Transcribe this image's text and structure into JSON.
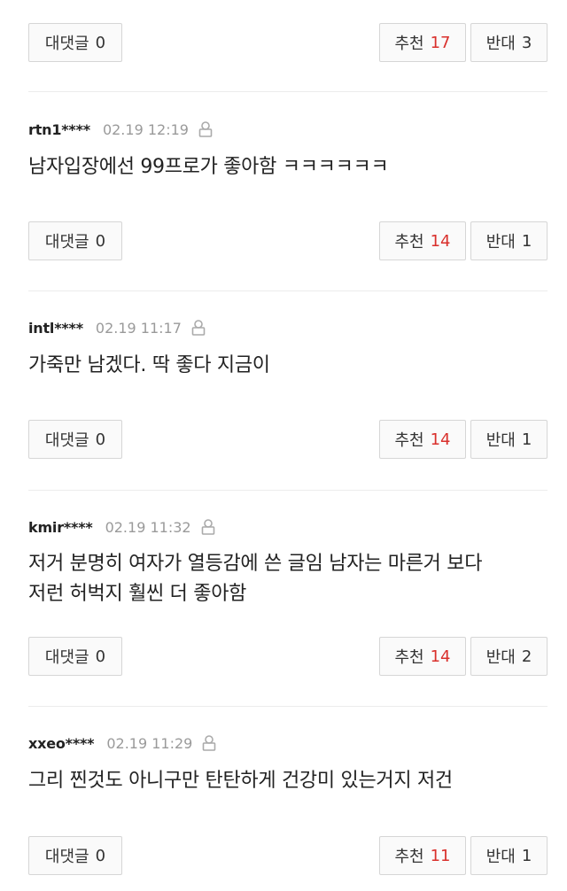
{
  "labels": {
    "reply": "대댓글",
    "up": "추천",
    "down": "반대"
  },
  "colors": {
    "up_count": "#d9302c",
    "date": "#9a9a9a",
    "divider": "#ececec"
  },
  "icons": {
    "user_lock": "user-lock-icon"
  },
  "top_comment": {
    "replies": "0",
    "up": "17",
    "down": "3"
  },
  "comments": [
    {
      "user": "rtn1****",
      "date": "02.19 12:19",
      "text": [
        "남자입장에선 99프로가 좋아함 ㅋㅋㅋㅋㅋㅋ"
      ],
      "replies": "0",
      "up": "14",
      "down": "1"
    },
    {
      "user": "intl****",
      "date": "02.19 11:17",
      "text": [
        "가죽만 남겠다. 딱 좋다 지금이"
      ],
      "replies": "0",
      "up": "14",
      "down": "1"
    },
    {
      "user": "kmir****",
      "date": "02.19 11:32",
      "text": [
        "저거 분명히 여자가 열등감에 쓴 글임 남자는 마른거 보다",
        "저런 허벅지 훨씬 더 좋아함"
      ],
      "replies": "0",
      "up": "14",
      "down": "2"
    },
    {
      "user": "xxeo****",
      "date": "02.19 11:29",
      "text": [
        "그리 찐것도 아니구만 탄탄하게 건강미 있는거지 저건"
      ],
      "replies": "0",
      "up": "11",
      "down": "1"
    }
  ]
}
